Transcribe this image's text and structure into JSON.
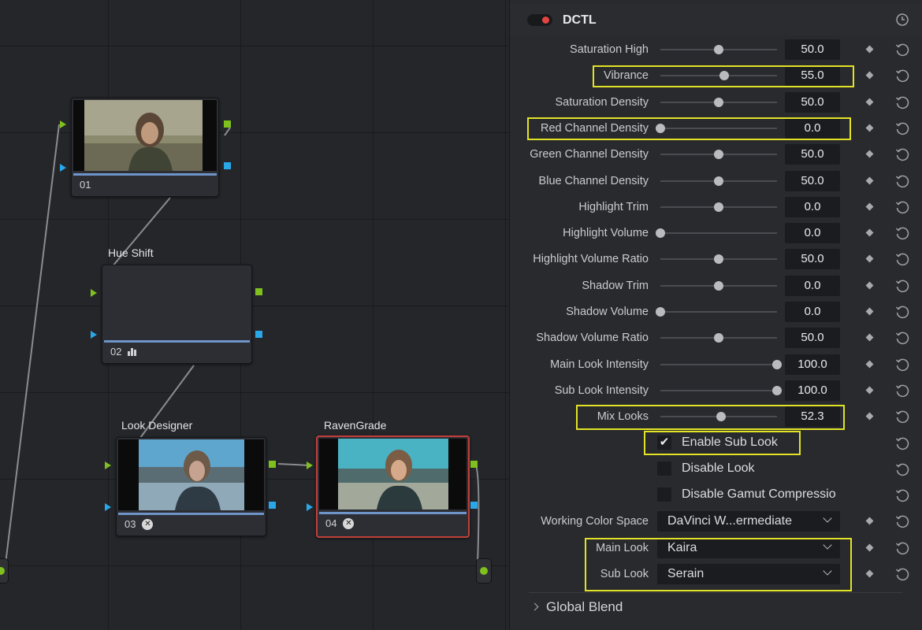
{
  "nodes": [
    {
      "id": "01",
      "label": "01",
      "title": ""
    },
    {
      "id": "02",
      "label": "02",
      "title": "Hue Shift"
    },
    {
      "id": "03",
      "label": "03",
      "title": "Look Designer"
    },
    {
      "id": "04",
      "label": "04",
      "title": "RavenGrade"
    }
  ],
  "panel": {
    "title": "DCTL",
    "sliders": [
      {
        "label": "Saturation High",
        "value": "50.0",
        "fraction": 0.5
      },
      {
        "label": "Vibrance",
        "value": "55.0",
        "fraction": 0.55
      },
      {
        "label": "Saturation Density",
        "value": "50.0",
        "fraction": 0.5
      },
      {
        "label": "Red Channel Density",
        "value": "0.0",
        "fraction": 0.0
      },
      {
        "label": "Green Channel Density",
        "value": "50.0",
        "fraction": 0.5
      },
      {
        "label": "Blue Channel Density",
        "value": "50.0",
        "fraction": 0.5
      },
      {
        "label": "Highlight Trim",
        "value": "0.0",
        "fraction": 0.5
      },
      {
        "label": "Highlight Volume",
        "value": "0.0",
        "fraction": 0.0
      },
      {
        "label": "Highlight Volume Ratio",
        "value": "50.0",
        "fraction": 0.5
      },
      {
        "label": "Shadow Trim",
        "value": "0.0",
        "fraction": 0.5
      },
      {
        "label": "Shadow Volume",
        "value": "0.0",
        "fraction": 0.0
      },
      {
        "label": "Shadow Volume Ratio",
        "value": "50.0",
        "fraction": 0.5
      },
      {
        "label": "Main Look Intensity",
        "value": "100.0",
        "fraction": 1.0
      },
      {
        "label": "Sub Look Intensity",
        "value": "100.0",
        "fraction": 1.0
      },
      {
        "label": "Mix Looks",
        "value": "52.3",
        "fraction": 0.523
      }
    ],
    "checkboxes": [
      {
        "label": "Enable Sub Look",
        "checked": true
      },
      {
        "label": "Disable Look",
        "checked": false
      },
      {
        "label": "Disable Gamut Compressio",
        "checked": false
      }
    ],
    "selects": [
      {
        "label": "Working Color Space",
        "value": "DaVinci W...ermediate"
      },
      {
        "label": "Main Look",
        "value": "Kaira"
      },
      {
        "label": "Sub Look",
        "value": "Serain"
      }
    ],
    "global_blend": "Global Blend"
  },
  "colors": {
    "highlight": "#e2e326",
    "accent": "#d6423c",
    "green_port": "#7fc01f",
    "blue_port": "#2aa7e6"
  }
}
